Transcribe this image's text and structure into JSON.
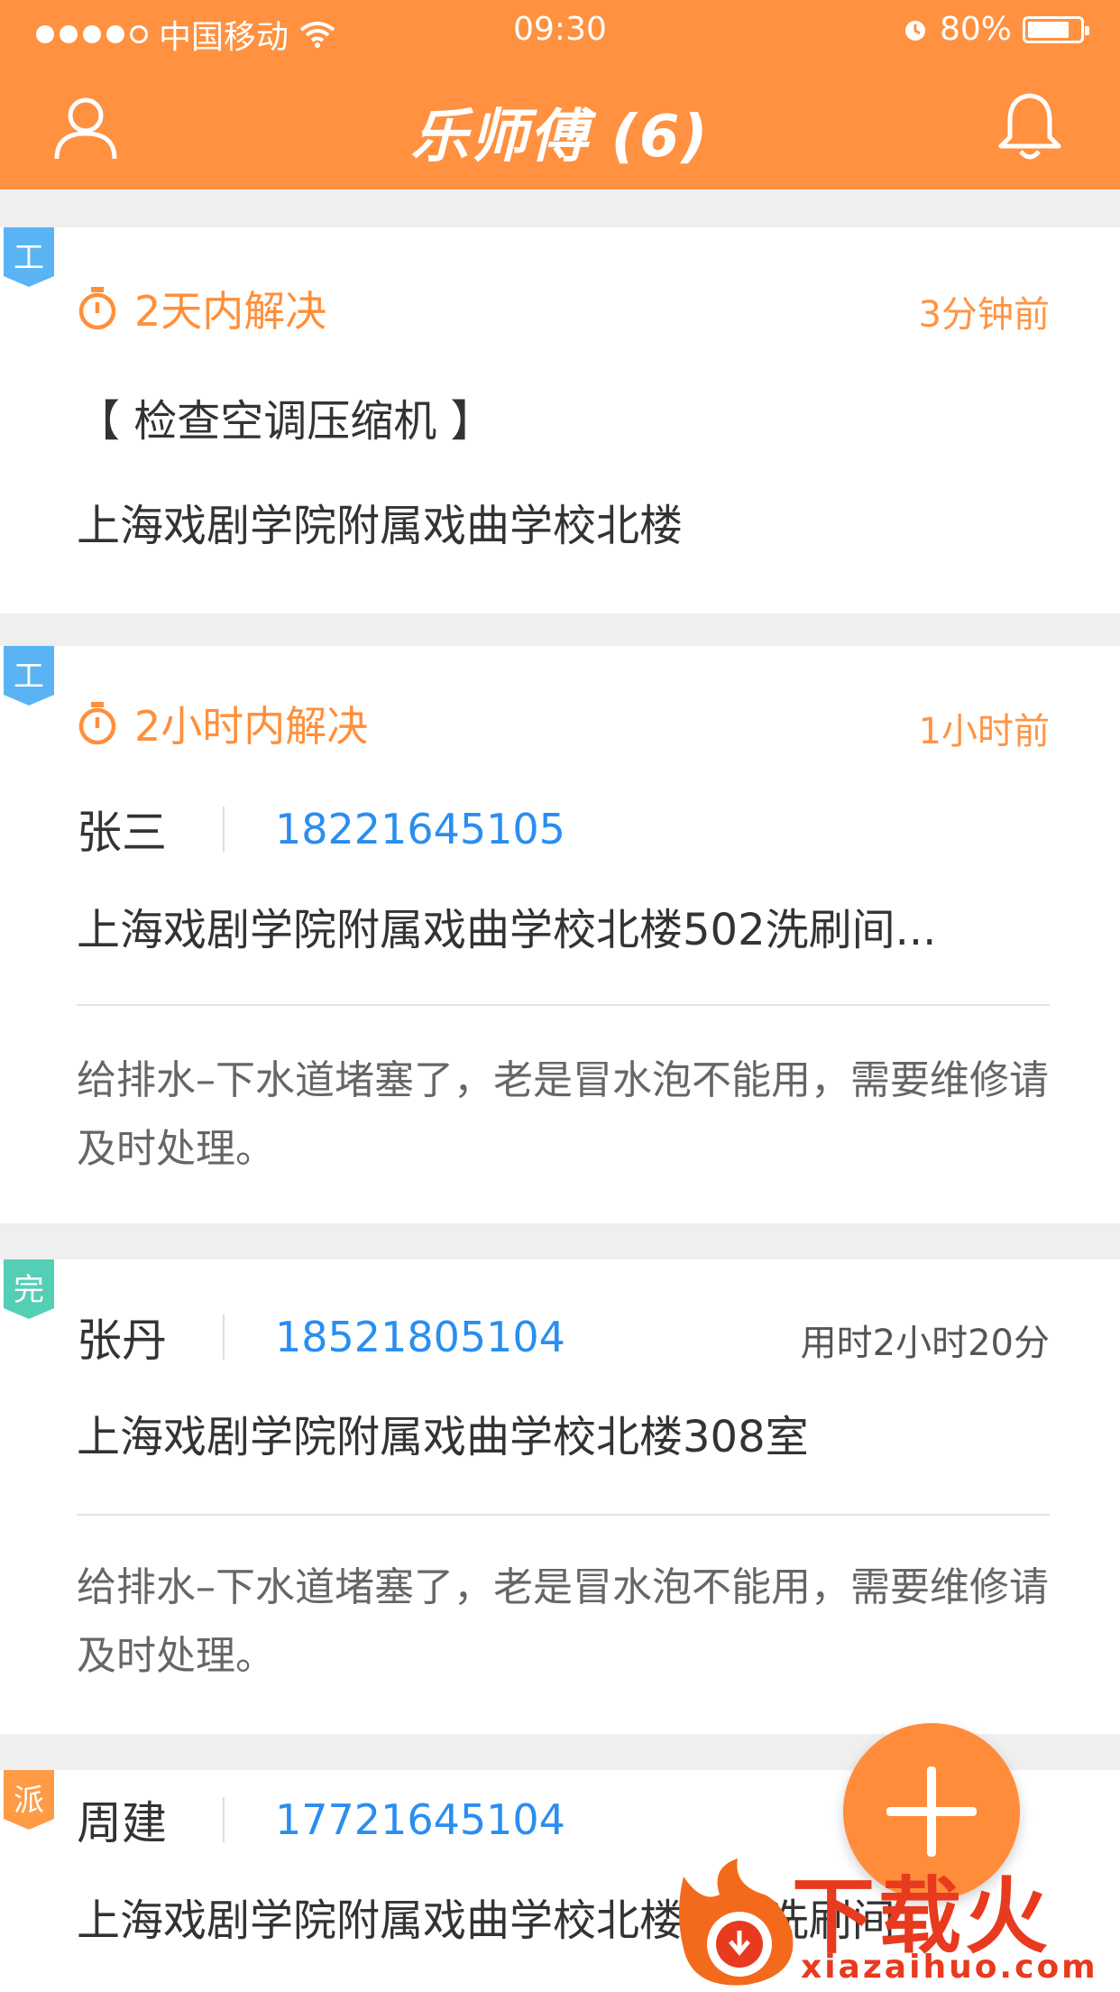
{
  "status_bar": {
    "carrier": "中国移动",
    "time": "09:30",
    "battery": "80%",
    "battery_level": 0.8
  },
  "nav": {
    "title": "乐师傅 (6)",
    "user_icon": "user-icon",
    "bell_icon": "bell-icon"
  },
  "orders": [
    {
      "tag": "工",
      "urgency": "2天内解决",
      "ago": "3分钟前",
      "title": "【 检查空调压缩机 】",
      "address": "上海戏剧学院附属戏曲学校北楼"
    },
    {
      "tag": "工",
      "urgency": "2小时内解决",
      "ago": "1小时前",
      "name": "张三",
      "phone": "18221645105",
      "address": "上海戏剧学院附属戏曲学校北楼502洗刷间...",
      "description": "给排水–下水道堵塞了，老是冒水泡不能用，需要维修请及时处理。"
    },
    {
      "tag": "完",
      "name": "张丹",
      "phone": "18521805104",
      "duration": "用时2小时20分",
      "address": "上海戏剧学院附属戏曲学校北楼308室",
      "description": "给排水–下水道堵塞了，老是冒水泡不能用，需要维修请及时处理。"
    },
    {
      "tag": "派",
      "name": "周建",
      "phone": "17721645104",
      "address": "上海戏剧学院附属戏曲学校北楼502洗刷间"
    }
  ],
  "watermark": {
    "main": "下载火",
    "sub": "xiazaihuo.com"
  },
  "colors": {
    "accent": "#ff9140",
    "phone": "#2a8ef0",
    "tag_work": "#5ab4f4",
    "tag_done": "#54cfb6",
    "tag_dispatch": "#ff9a45"
  }
}
